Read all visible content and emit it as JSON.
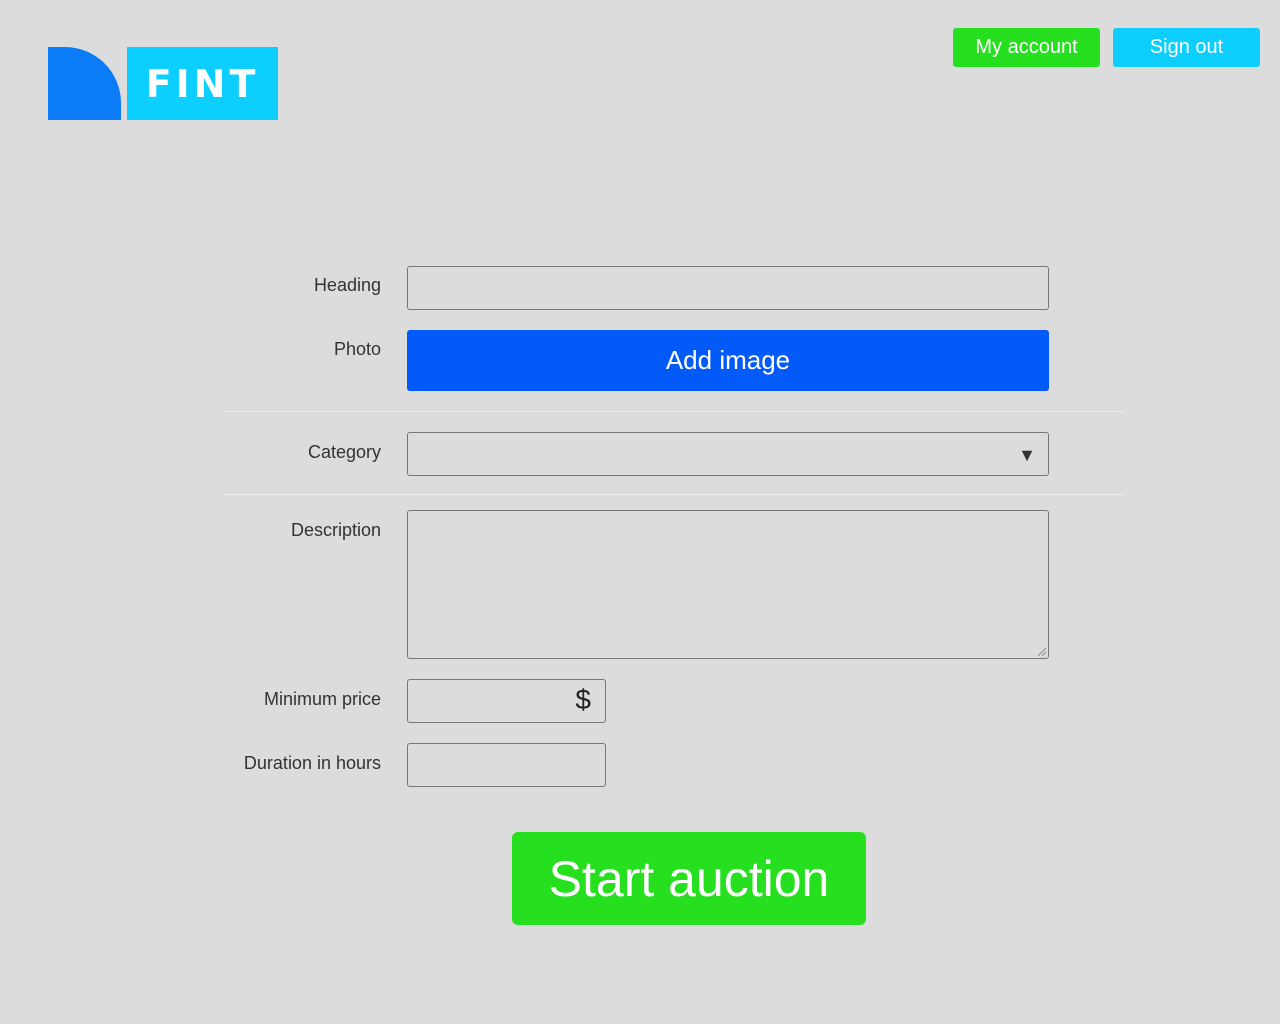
{
  "logo": {
    "text": "FINT"
  },
  "header": {
    "my_account": "My account",
    "sign_out": "Sign out"
  },
  "form": {
    "heading_label": "Heading",
    "heading_value": "",
    "photo_label": "Photo",
    "add_image": "Add image",
    "category_label": "Category",
    "category_value": "",
    "category_arrow": "▼",
    "description_label": "Description",
    "description_value": "",
    "min_price_label": "Minimum price",
    "min_price_value": "",
    "currency_symbol": "$",
    "duration_label": "Duration in hours",
    "duration_value": "",
    "submit": "Start auction"
  },
  "colors": {
    "background": "#dcdcdc",
    "green": "#26e020",
    "cyan": "#0ccfff",
    "blue": "#025af8",
    "logo_blue": "#0a7cf8"
  }
}
